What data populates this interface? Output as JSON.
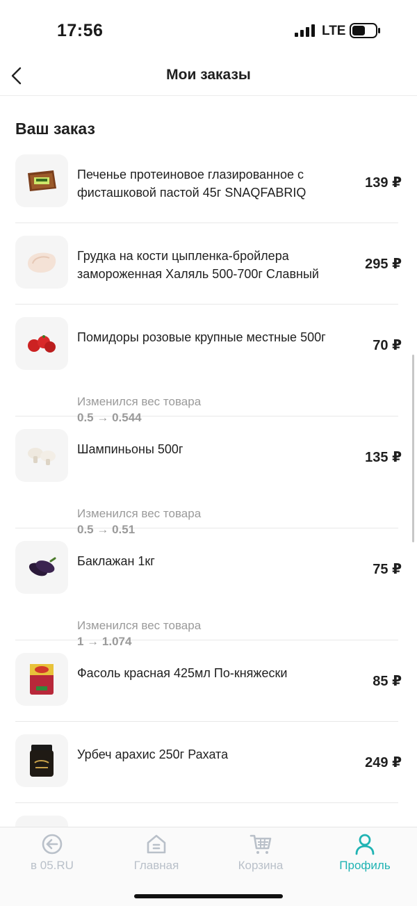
{
  "status_bar": {
    "time": "17:56",
    "network": "LTE"
  },
  "header": {
    "title": "Мои заказы",
    "back_icon": "chevron-left-icon"
  },
  "section_title": "Ваш заказ",
  "items": [
    {
      "name": "Печенье протеиновое глазированное с фисташковой пастой 45г SNAQFABRIQ",
      "price": "139 ₽",
      "image": "protein-cookie-image"
    },
    {
      "name": "Грудка на кости цыпленка-бройлера замороженная Халяль 500-700г Славный",
      "price": "295 ₽",
      "image": "chicken-breast-image"
    },
    {
      "name": "Помидоры розовые крупные местные 500г",
      "price": "70 ₽",
      "image": "tomatoes-image",
      "weight_label": "Изменился вес товара",
      "weight_change": "0.5 → 0.544"
    },
    {
      "name": "Шампиньоны 500г",
      "price": "135 ₽",
      "image": "mushrooms-image",
      "weight_label": "Изменился вес товара",
      "weight_change": "0.5 → 0.51"
    },
    {
      "name": "Баклажан 1кг",
      "price": "75 ₽",
      "image": "eggplant-image",
      "weight_label": "Изменился вес товара",
      "weight_change": "1 → 1.074"
    },
    {
      "name": "Фасоль красная 425мл По-княжески",
      "price": "85 ₽",
      "image": "red-beans-can-image"
    },
    {
      "name": "Урбеч арахис 250г Рахата",
      "price": "249 ₽",
      "image": "urbech-jar-image"
    }
  ],
  "tab_bar": {
    "tabs": [
      {
        "label": "в 05.RU",
        "icon": "back-circle-icon"
      },
      {
        "label": "Главная",
        "icon": "home-icon"
      },
      {
        "label": "Корзина",
        "icon": "cart-icon"
      },
      {
        "label": "Профиль",
        "icon": "profile-icon",
        "active": true
      }
    ]
  },
  "colors": {
    "accent": "#1fb3b3",
    "inactive": "#b9c0c9",
    "muted_text": "#9a9a9a"
  }
}
